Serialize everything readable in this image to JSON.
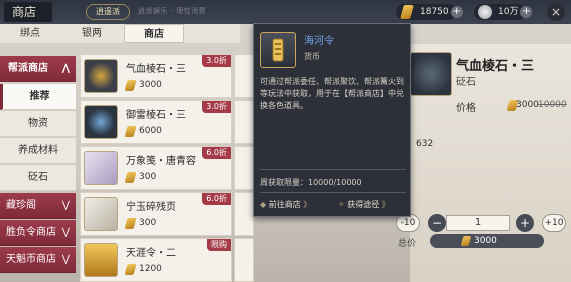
{
  "header": {
    "title": "商店",
    "badge": "逍遥派",
    "subtitle": "逍遥娱乐 · 理性消费",
    "currency1": {
      "value": "18750",
      "icon": "coin-icon"
    },
    "currency2": {
      "value": "10万",
      "icon": "silver-coin-icon"
    },
    "close_icon": "×"
  },
  "tabs": [
    {
      "label": "绑点"
    },
    {
      "label": "银两"
    },
    {
      "label": "商店",
      "active": true
    }
  ],
  "nav": {
    "header": "帮派商店",
    "header_chev": "⋀",
    "items": [
      {
        "label": "推荐",
        "active": true
      },
      {
        "label": "物资"
      },
      {
        "label": "养成材料"
      },
      {
        "label": "砭石"
      }
    ],
    "groups": [
      {
        "label": "藏珍阁",
        "chev": "⋁"
      },
      {
        "label": "胜负令商店",
        "chev": "⋁"
      },
      {
        "label": "天魁币商店",
        "chev": "⋁"
      }
    ]
  },
  "items": [
    {
      "name": "气血棱石・三",
      "price": "3000",
      "tag": "3.0折"
    },
    {
      "name": "御雷棱石・三",
      "price": "6000",
      "tag": "3.0折"
    },
    {
      "name": "万象笺・唐青容",
      "price": "300",
      "tag": "6.0折"
    },
    {
      "name": "宁玉碎残页",
      "price": "300",
      "tag": "6.0折"
    },
    {
      "name": "天涯令・二",
      "price": "1200",
      "tag": "限购"
    }
  ],
  "tooltip": {
    "name": "海河令",
    "type": "货币",
    "desc": "可通过帮派委任、帮派聚饮、帮派篝火到等玩法中获取，用于在【帮派商店】中兑换各色道具。",
    "limit": "周获取限量：10000/10000",
    "btn_shop": "前往商店",
    "btn_source": "获得途径",
    "arrow": "》"
  },
  "detail": {
    "title": "气血棱石・三",
    "subtitle": "砭石",
    "price_label": "价格",
    "price": "3000",
    "price_old": "10000",
    "stock": "632",
    "minus10": "-10",
    "minus": "−",
    "quantity": "1",
    "plus": "+",
    "plus10": "+10",
    "total_label": "总价",
    "total": "3000"
  },
  "colors": {
    "nav_red": "#8b3141",
    "tag_red": "#a53a48",
    "tooltip_bg": "#2d3038",
    "tooltip_name": "#6fa6e8"
  }
}
